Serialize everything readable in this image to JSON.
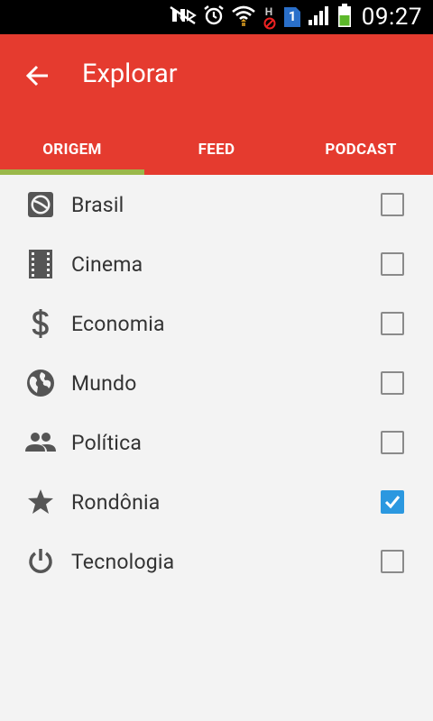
{
  "status_bar": {
    "time": "09:27",
    "sim_badge": "1",
    "network_letter": "H",
    "icons": [
      "mute-icon",
      "alarm-icon",
      "wifi-icon",
      "network-blocked-icon",
      "sim-icon",
      "signal-icon",
      "battery-icon"
    ]
  },
  "app_bar": {
    "title": "Explorar",
    "back_icon": "arrow-back-icon",
    "background": "#e53b2f"
  },
  "tabs": [
    {
      "label": "ORIGEM",
      "selected": true
    },
    {
      "label": "FEED",
      "selected": false
    },
    {
      "label": "PODCAST",
      "selected": false
    }
  ],
  "tab_indicator_color": "#9ab84a",
  "categories": [
    {
      "label": "Brasil",
      "icon": "ball-icon",
      "checked": false
    },
    {
      "label": "Cinema",
      "icon": "film-icon",
      "checked": false
    },
    {
      "label": "Economia",
      "icon": "dollar-icon",
      "checked": false
    },
    {
      "label": "Mundo",
      "icon": "globe-icon",
      "checked": false
    },
    {
      "label": "Política",
      "icon": "people-icon",
      "checked": false
    },
    {
      "label": "Rondônia",
      "icon": "star-icon",
      "checked": true
    },
    {
      "label": "Tecnologia",
      "icon": "power-icon",
      "checked": false
    }
  ],
  "checkbox_checked_color": "#2b98e0"
}
